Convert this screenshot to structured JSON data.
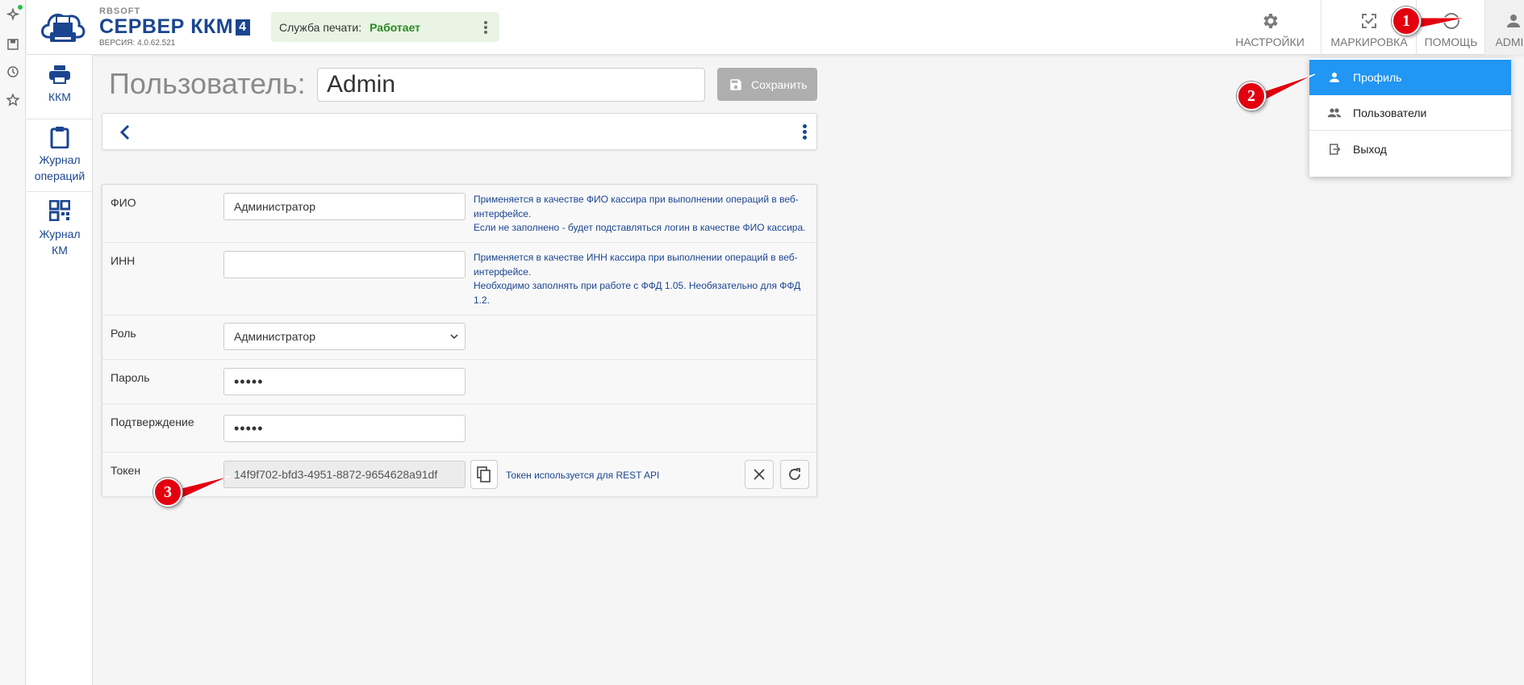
{
  "header": {
    "brand_company": "RBSOFT",
    "brand_product": "СЕРВЕР ККМ",
    "brand_version_badge": "4",
    "version_text": "ВЕРСИЯ: 4.0.62.521",
    "print_service_label": "Служба печати:",
    "print_service_status": "Работает",
    "nav": {
      "settings": "НАСТРОЙКИ",
      "marking": "МАРКИРОВКА",
      "help": "ПОМОЩЬ",
      "admin": "ADMIN"
    }
  },
  "sidenav": {
    "kkm": "ККМ",
    "journal_line1": "Журнал",
    "journal_line2": "операций",
    "km_line1": "Журнал",
    "km_line2": "КМ"
  },
  "page": {
    "title": "Пользователь:",
    "username_value": "Admin",
    "save_label": "Сохранить"
  },
  "form": {
    "fio_label": "ФИО",
    "fio_value": "Администратор",
    "fio_hint_1": "Применяется в качестве ФИО кассира при выполнении операций в веб-интерфейсе.",
    "fio_hint_2": "Если не заполнено - будет подставляться логин в качестве ФИО кассира.",
    "inn_label": "ИНН",
    "inn_value": "",
    "inn_hint_1": "Применяется в качестве ИНН кассира при выполнении операций в веб-интерфейсе.",
    "inn_hint_2": "Необходимо заполнять при работе с ФФД 1.05. Необязательно для ФФД 1.2.",
    "role_label": "Роль",
    "role_value": "Администратор",
    "password_label": "Пароль",
    "password_value": "•••••",
    "confirm_label": "Подтверждение",
    "confirm_value": "•••••",
    "token_label": "Токен",
    "token_value": "14f9f702-bfd3-4951-8872-9654628a91df",
    "token_hint": "Токен используется для REST API"
  },
  "menu": {
    "profile": "Профиль",
    "users": "Пользователи",
    "logout": "Выход"
  },
  "annotations": {
    "badge_1": "1",
    "badge_2": "2",
    "badge_3": "3",
    "color": "#e3000f"
  }
}
